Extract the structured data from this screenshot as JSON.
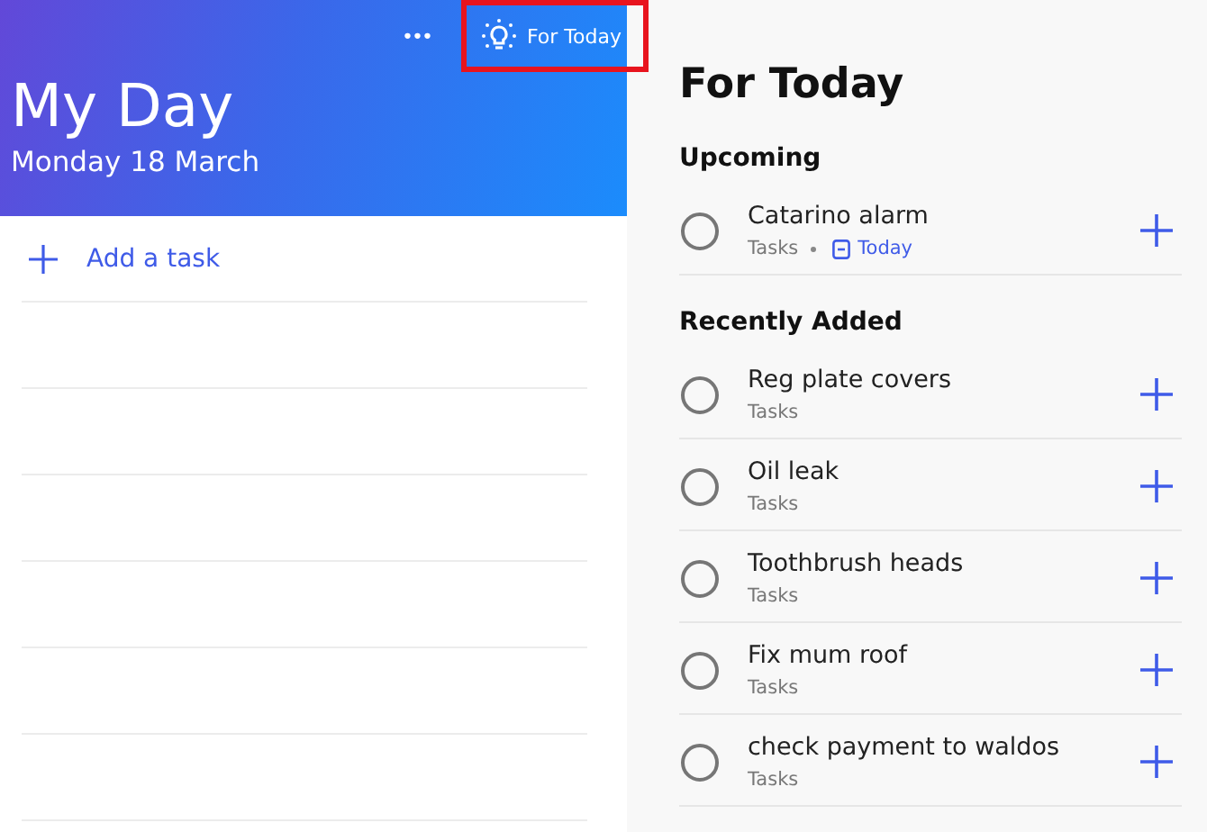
{
  "header": {
    "title": "My Day",
    "date": "Monday 18 March",
    "more_button": {
      "label": "•••"
    },
    "for_today_button": {
      "label": "For Today",
      "highlighted": true
    }
  },
  "add_task": {
    "label": "Add a task"
  },
  "panel": {
    "title": "For Today",
    "sections": [
      {
        "title": "Upcoming",
        "tasks": [
          {
            "title": "Catarino alarm",
            "list": "Tasks",
            "due": "Today",
            "completed": false
          }
        ]
      },
      {
        "title": "Recently Added",
        "tasks": [
          {
            "title": "Reg plate covers",
            "list": "Tasks",
            "completed": false
          },
          {
            "title": "Oil leak",
            "list": "Tasks",
            "completed": false
          },
          {
            "title": "Toothbrush heads",
            "list": "Tasks",
            "completed": false
          },
          {
            "title": "Fix mum roof",
            "list": "Tasks",
            "completed": false
          },
          {
            "title": "check payment to waldos",
            "list": "Tasks",
            "completed": false
          }
        ]
      }
    ]
  }
}
